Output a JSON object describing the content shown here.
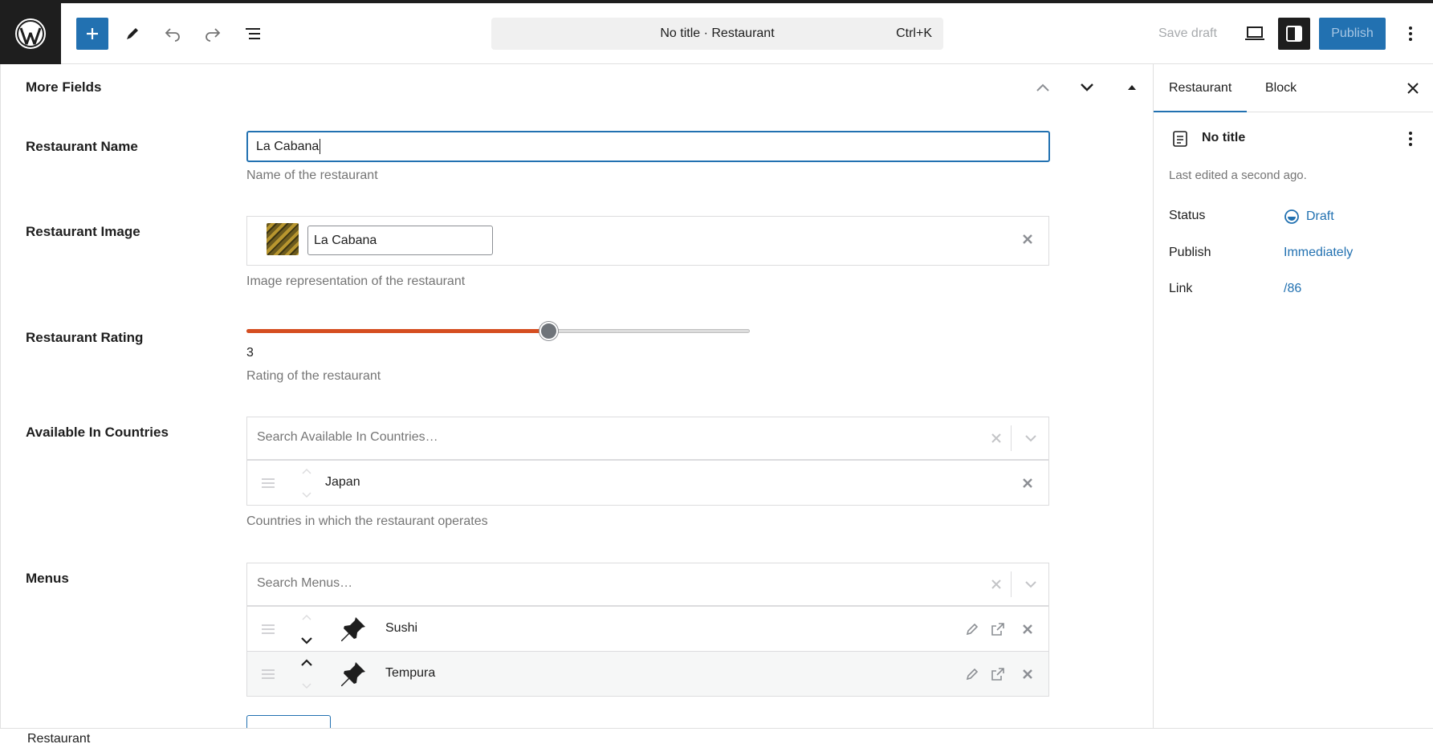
{
  "topbar": {
    "document_title": "No title · Restaurant",
    "shortcut": "Ctrl+K",
    "save_draft_label": "Save draft",
    "publish_label": "Publish"
  },
  "panel": {
    "title": "More Fields"
  },
  "fields": {
    "name": {
      "label": "Restaurant Name",
      "value": "La Cabana",
      "help": "Name of the restaurant"
    },
    "image": {
      "label": "Restaurant Image",
      "value": "La Cabana",
      "help": "Image representation of the restaurant"
    },
    "rating": {
      "label": "Restaurant Rating",
      "value": "3",
      "fraction": 0.6,
      "help": "Rating of the restaurant"
    },
    "countries": {
      "label": "Available In Countries",
      "placeholder": "Search Available In Countries…",
      "items": [
        "Japan"
      ],
      "help": "Countries in which the restaurant operates"
    },
    "menus": {
      "label": "Menus",
      "placeholder": "Search Menus…",
      "items": [
        "Sushi",
        "Tempura"
      ]
    }
  },
  "sidebar": {
    "tabs": [
      "Restaurant",
      "Block"
    ],
    "doc_title": "No title",
    "last_edited": "Last edited a second ago.",
    "rows": [
      {
        "label": "Status",
        "value": "Draft"
      },
      {
        "label": "Publish",
        "value": "Immediately"
      },
      {
        "label": "Link",
        "value": "/86"
      }
    ]
  },
  "footer": {
    "breadcrumb": "Restaurant"
  },
  "colors": {
    "accent": "#2271b1",
    "slider_fill": "#d54e21",
    "dark": "#1e1e1e"
  },
  "icons": [
    "wordpress-logo-icon",
    "plus-icon",
    "pencil-icon",
    "undo-icon",
    "redo-icon",
    "list-view-icon",
    "desktop-preview-icon",
    "sidebar-toggle-icon",
    "more-vertical-icon",
    "chevron-up-icon",
    "chevron-down-icon",
    "triangle-up-icon",
    "close-icon",
    "drag-handle-icon",
    "pin-icon",
    "edit-icon",
    "external-link-icon",
    "document-icon",
    "draft-status-icon"
  ]
}
